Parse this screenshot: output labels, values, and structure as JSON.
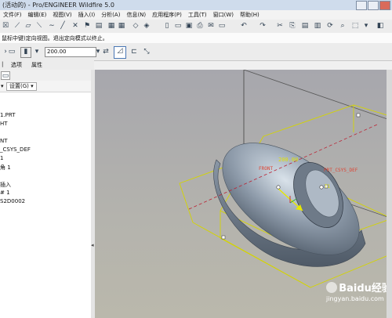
{
  "window": {
    "title": "(活动的) - Pro/ENGINEER Wildfire 5.0"
  },
  "menu": [
    "文件(F)",
    "编辑(E)",
    "视图(V)",
    "插入(I)",
    "分析(A)",
    "信息(N)",
    "应用程序(P)",
    "工具(T)",
    "窗口(W)",
    "帮助(H)"
  ],
  "status": {
    "message": "鼠标中键)定向视图。退出定向模式以终止。"
  },
  "dashboard": {
    "depth_value": "200.00"
  },
  "tabs": [
    "选项",
    "属性"
  ],
  "navigator": {
    "settings_label": "设置(G)",
    "items": [
      "1.PRT",
      "HT",
      "NT",
      "_CSYS_DEF",
      "1",
      "角 1",
      "插入",
      "# 1",
      "S2D0002"
    ]
  },
  "viewport": {
    "dimension_label": "200.00",
    "csys_label": "PRT_CSYS_DEF",
    "front_label": "FRONT",
    "extra_label": "T1"
  },
  "watermark": {
    "brand": "Baidu经验",
    "url": "jingyan.baidu.com"
  },
  "colors": {
    "accent": "#d4d400",
    "model": "#8c9aa8",
    "background": "#b4b3ad"
  }
}
